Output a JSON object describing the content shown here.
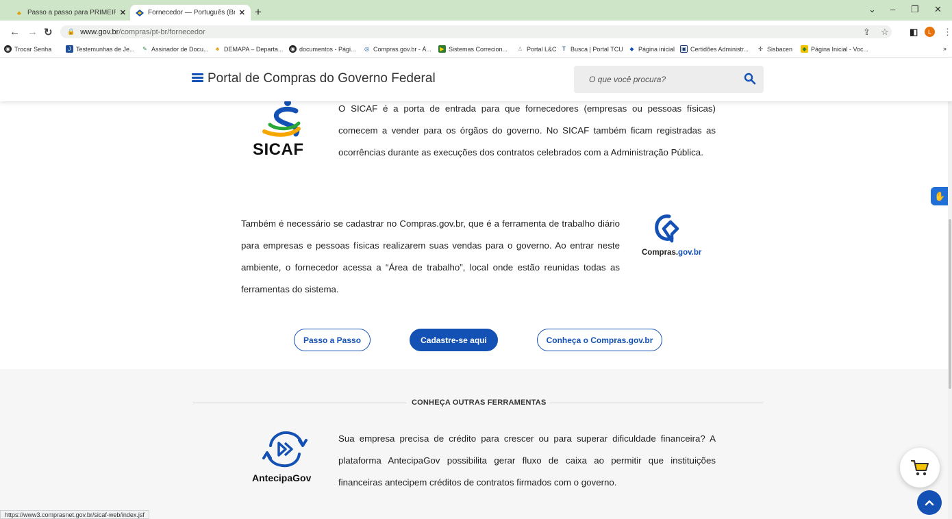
{
  "browser": {
    "tabs": [
      {
        "title": "Passo a passo para PRIMEIRO AC",
        "active": false
      },
      {
        "title": "Fornecedor — Português (Brasil)",
        "active": true
      }
    ],
    "new_tab": "+",
    "url_host": "www.gov.br",
    "url_path": "/compras/pt-br/fornecedor",
    "profile_initial": "L",
    "bookmarks": [
      "Trocar Senha",
      "Testemunhas de Je...",
      "Assinador de Docu...",
      "DEMAPA – Departa...",
      "documentos - Pági...",
      "Compras.gov.br - Á...",
      "Sistemas Correcion...",
      "Portal L&C",
      "Busca | Portal TCU",
      "Página inicial",
      "Certidões Administr...",
      "Sisbacen",
      "Página Inicial - Voc..."
    ],
    "bookmarks_more": "»",
    "status_url": "https://www3.comprasnet.gov.br/sicaf-web/index.jsf"
  },
  "header": {
    "title": "Portal de Compras do Governo Federal",
    "search_placeholder": "O que você procura?"
  },
  "sicaf": {
    "logo_text": "SICAF",
    "description": "O SICAF é a porta de entrada para que fornecedores (empresas ou pessoas físicas) comecem a vender para os órgãos do governo. No SICAF também ficam registradas as ocorrências durante as execuções dos contratos celebrados com a Administração Pública."
  },
  "compras": {
    "description": "Também é necessário se cadastrar no Compras.gov.br, que é a ferramenta de trabalho diário para empresas e pessoas físicas realizarem suas vendas para o governo. Ao entrar neste ambiente, o fornecedor acessa a “Área de trabalho”, local onde estão reunidas todas as ferramentas do sistema.",
    "logo_text_dark": "Compras.",
    "logo_text_blue": "gov.br"
  },
  "buttons": {
    "passo": "Passo a Passo",
    "cadastre": "Cadastre-se aqui",
    "conheca": "Conheça o Compras.gov.br"
  },
  "ferramentas": {
    "section_title": "CONHEÇA OUTRAS FERRAMENTAS",
    "antecipa_logo_text": "AntecipaGov",
    "antecipa_description": "Sua empresa precisa de crédito para crescer ou para superar dificuldade financeira? A plataforma AntecipaGov possibilita gerar fluxo de caixa ao permitir que instituições financeiras antecipem créditos de contratos firmados com o governo."
  },
  "colors": {
    "primary_blue": "#1351b4",
    "tabbar_green": "#cfe5c7",
    "section_bg": "#f6f6f6"
  }
}
